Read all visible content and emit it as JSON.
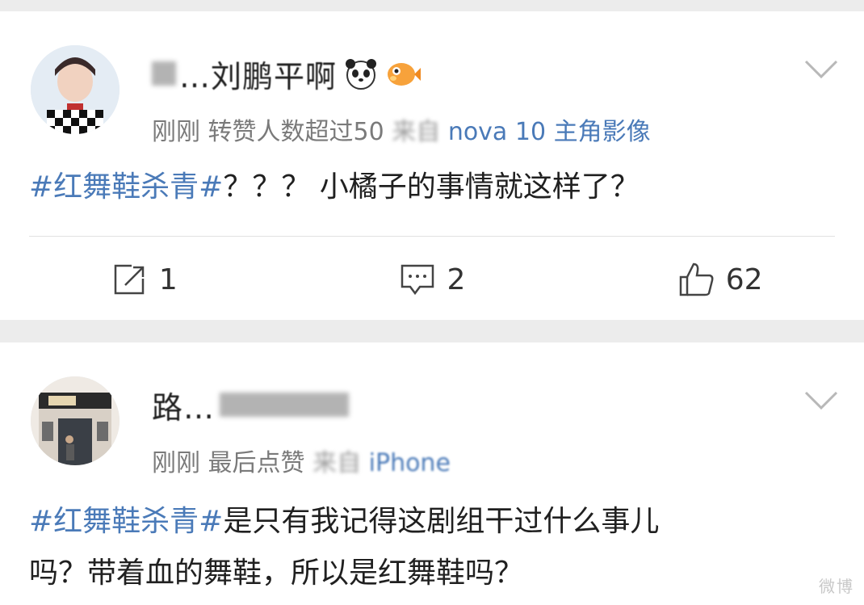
{
  "posts": [
    {
      "username": "…刘鹏平啊",
      "meta_prefix": "刚刚 转赞人数超过50",
      "meta_blurred": "来自",
      "meta_device": "nova 10 主角影像",
      "hashtag": "#红舞鞋杀青#",
      "body": "？？？ 小橘子的事情就这样了？",
      "repost_count": "1",
      "comment_count": "2",
      "like_count": "62",
      "avatar_icon": "avatar-boy-checkered",
      "emojis": [
        "panda-icon",
        "pufferfish-icon"
      ]
    },
    {
      "username": "路…",
      "meta_prefix": "刚刚 最后点赞",
      "meta_blurred": "来自",
      "meta_device": "iPhone",
      "hashtag": "#红舞鞋杀青#",
      "body_line1": "是只有我记得这剧组干过什么事儿",
      "body_line2": "吗？带着血的舞鞋，所以是红舞鞋吗？",
      "avatar_icon": "avatar-storefront"
    }
  ],
  "colors": {
    "link": "#4a7ab8",
    "meta": "#7a7a7a",
    "background": "#ececec"
  },
  "watermark": "微博"
}
